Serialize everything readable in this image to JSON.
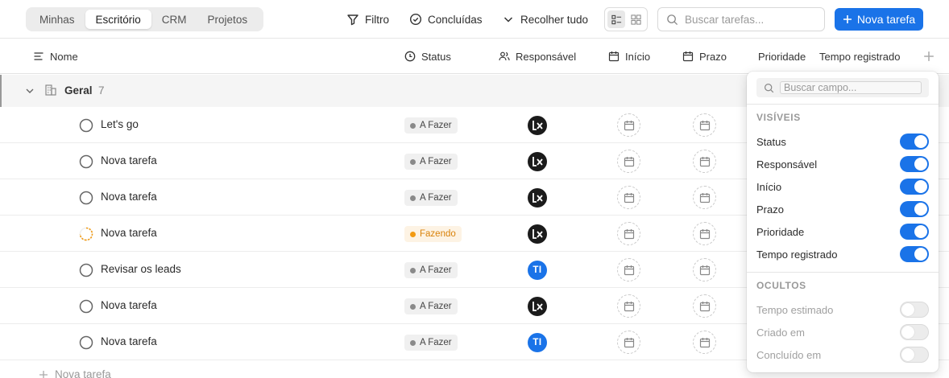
{
  "tabs": [
    {
      "label": "Minhas",
      "active": false
    },
    {
      "label": "Escritório",
      "active": true
    },
    {
      "label": "CRM",
      "active": false
    },
    {
      "label": "Projetos",
      "active": false
    }
  ],
  "toolbar": {
    "filter_label": "Filtro",
    "completed_label": "Concluídas",
    "collapse_label": "Recolher tudo",
    "search_placeholder": "Buscar tarefas...",
    "new_task_label": "Nova tarefa"
  },
  "columns": {
    "name": "Nome",
    "status": "Status",
    "assignee": "Responsável",
    "start": "Início",
    "due": "Prazo",
    "priority": "Prioridade",
    "time": "Tempo registrado"
  },
  "group": {
    "name": "Geral",
    "count": "7"
  },
  "tasks": [
    {
      "name": "Let's go",
      "status": "A Fazer",
      "state": "todo",
      "assignee": "logo"
    },
    {
      "name": "Nova tarefa",
      "status": "A Fazer",
      "state": "todo",
      "assignee": "logo"
    },
    {
      "name": "Nova tarefa",
      "status": "A Fazer",
      "state": "todo",
      "assignee": "logo"
    },
    {
      "name": "Nova tarefa",
      "status": "Fazendo",
      "state": "doing",
      "assignee": "logo"
    },
    {
      "name": "Revisar os leads",
      "status": "A Fazer",
      "state": "todo",
      "assignee": "TI"
    },
    {
      "name": "Nova tarefa",
      "status": "A Fazer",
      "state": "todo",
      "assignee": "logo"
    },
    {
      "name": "Nova tarefa",
      "status": "A Fazer",
      "state": "todo",
      "assignee": "TI"
    }
  ],
  "add_task_label": "Nova tarefa",
  "field_panel": {
    "search_placeholder": "Buscar campo...",
    "visible_title": "VISÍVEIS",
    "hidden_title": "OCULTOS",
    "visible": [
      "Status",
      "Responsável",
      "Início",
      "Prazo",
      "Prioridade",
      "Tempo registrado"
    ],
    "hidden": [
      "Tempo estimado",
      "Criado em",
      "Concluído em"
    ]
  },
  "colors": {
    "accent": "#1a73e8",
    "doing": "#f29a12",
    "todo_dot": "#8a8a8a"
  }
}
